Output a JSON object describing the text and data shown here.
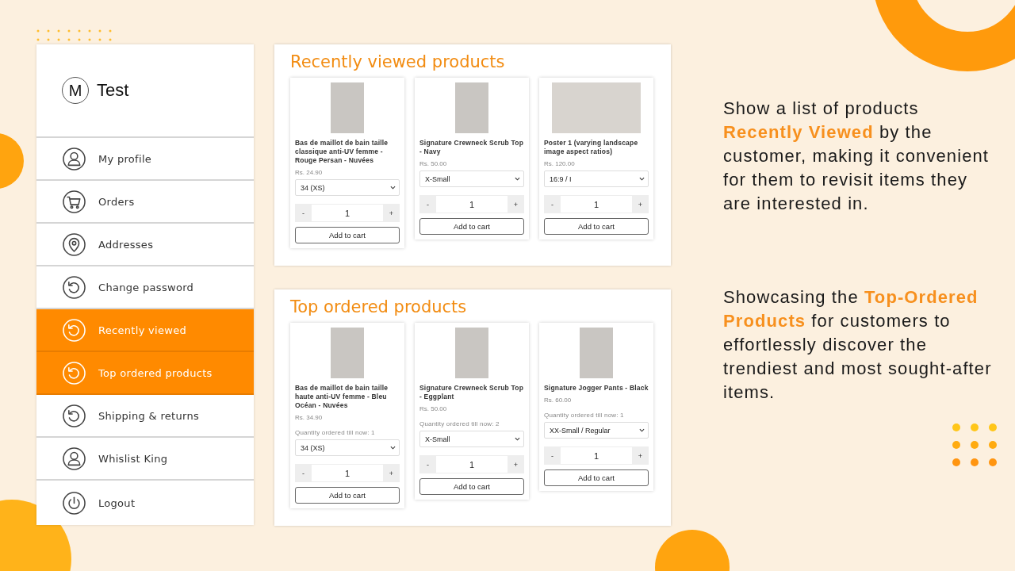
{
  "sidebar": {
    "avatar_letter": "M",
    "user_name": "Test",
    "items": [
      {
        "label": "My profile",
        "kind": "person",
        "selected": false
      },
      {
        "label": "Orders",
        "kind": "cart",
        "selected": false
      },
      {
        "label": "Addresses",
        "kind": "pin",
        "selected": false
      },
      {
        "label": "Change password",
        "kind": "refresh",
        "selected": false
      },
      {
        "label": "Recently viewed",
        "kind": "refresh",
        "selected": true
      },
      {
        "label": "Top ordered products",
        "kind": "refresh",
        "selected": true
      },
      {
        "label": "Shipping & returns",
        "kind": "refresh",
        "selected": false
      },
      {
        "label": "Whislist King",
        "kind": "person",
        "selected": false
      },
      {
        "label": "Logout",
        "kind": "power",
        "selected": false
      }
    ]
  },
  "recently_viewed": {
    "title": "Recently viewed products",
    "products": [
      {
        "name": "Bas de maillot de bain taille classique anti-UV femme - Rouge Persan - Nuvées",
        "price": "Rs. 24.90",
        "option": "34 (XS)",
        "quantity": "1",
        "minus": "-",
        "plus": "+",
        "button": "Add to cart",
        "kind": "portrait"
      },
      {
        "name": "Signature Crewneck Scrub Top - Navy",
        "price": "Rs. 50.00",
        "option": "X-Small",
        "quantity": "1",
        "minus": "-",
        "plus": "+",
        "button": "Add to cart",
        "kind": "portrait"
      },
      {
        "name": "Poster 1 (varying landscape image aspect ratios)",
        "price": "Rs. 120.00",
        "option": "16:9 / I",
        "quantity": "1",
        "minus": "-",
        "plus": "+",
        "button": "Add to cart",
        "kind": "landscape"
      }
    ]
  },
  "top_ordered": {
    "title": "Top ordered products",
    "products": [
      {
        "name": "Bas de maillot de bain taille haute anti-UV femme - Bleu Océan - Nuvées",
        "price": "Rs. 34.90",
        "ordered_note": "Quantity ordered till now: 1",
        "option": "34 (XS)",
        "quantity": "1",
        "minus": "-",
        "plus": "+",
        "button": "Add to cart",
        "kind": "portrait"
      },
      {
        "name": "Signature Crewneck Scrub Top - Eggplant",
        "price": "Rs. 50.00",
        "ordered_note": "Quantity ordered till now: 2",
        "option": "X-Small",
        "quantity": "1",
        "minus": "-",
        "plus": "+",
        "button": "Add to cart",
        "kind": "portrait"
      },
      {
        "name": "Signature Jogger Pants - Black",
        "price": "Rs. 60.00",
        "ordered_note": "Quantity ordered till now: 1",
        "option": "XX-Small / Regular",
        "quantity": "1",
        "minus": "-",
        "plus": "+",
        "button": "Add to cart",
        "kind": "portrait"
      }
    ]
  },
  "captions": [
    "Show a list of products **Recently Viewed** by the customer, making it convenient for them to revisit items they are interested in.",
    "Showcasing the **Top-Ordered Products** for customers to effortlessly discover the trendiest and most sought-after items."
  ]
}
